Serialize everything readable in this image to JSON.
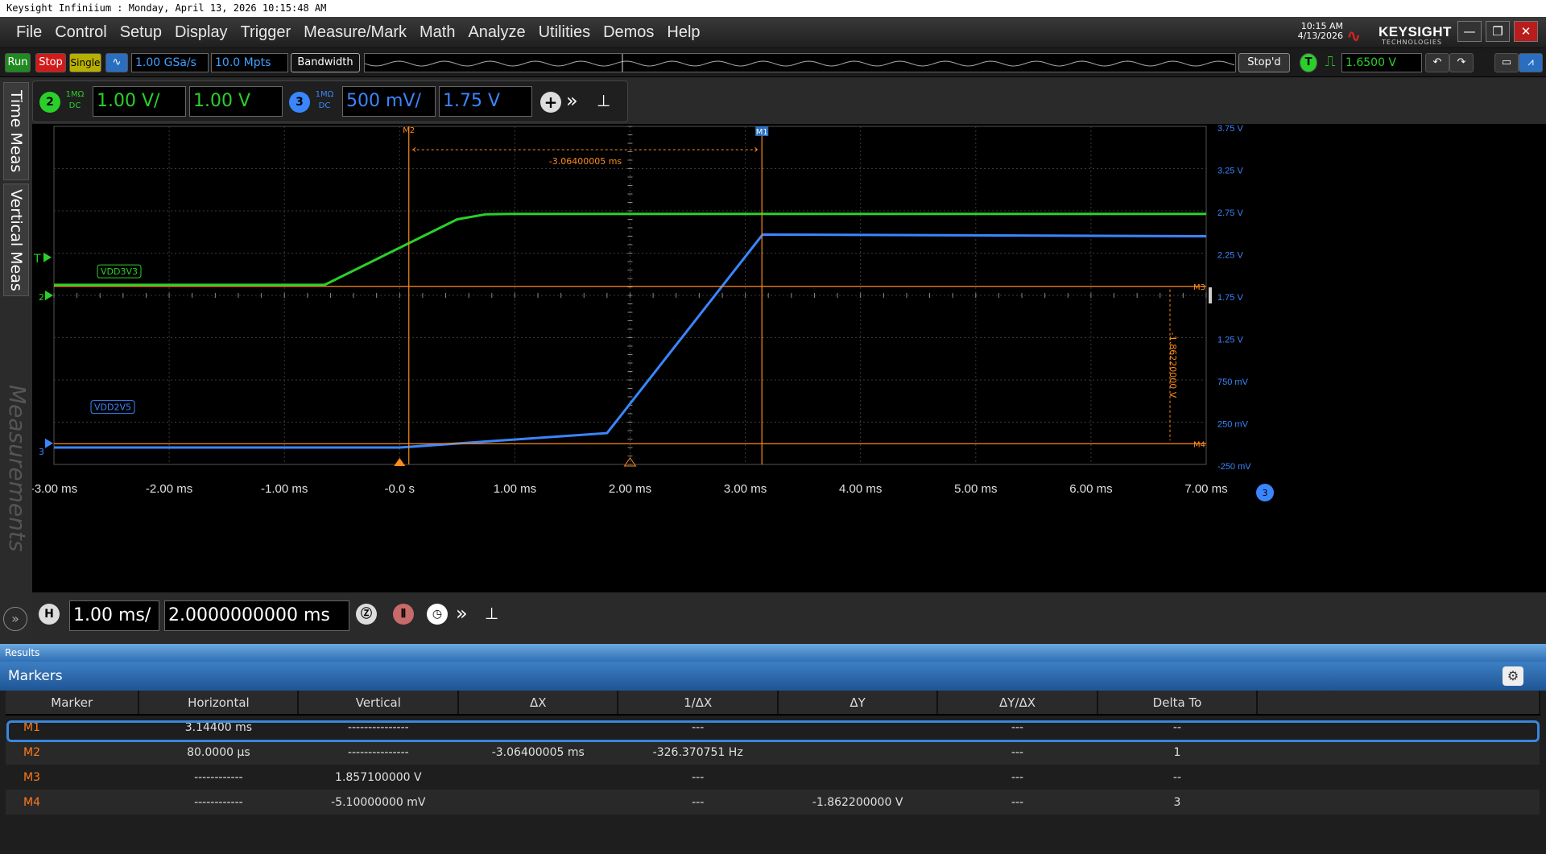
{
  "window": {
    "title": "Keysight Infiniium : Monday, April 13, 2026 10:15:48 AM"
  },
  "menu": [
    "File",
    "Control",
    "Setup",
    "Display",
    "Trigger",
    "Measure/Mark",
    "Math",
    "Analyze",
    "Utilities",
    "Demos",
    "Help"
  ],
  "clock": {
    "time": "10:15 AM",
    "date": "4/13/2026"
  },
  "brand": {
    "name": "KEYSIGHT",
    "sub": "TECHNOLOGIES"
  },
  "toolbar": {
    "run": "Run",
    "stop": "Stop",
    "single": "Single",
    "sample_rate": "1.00 GSa/s",
    "memory": "10.0 Mpts",
    "bandwidth": "Bandwidth",
    "status": "Stop'd",
    "trigger_label": "T",
    "trigger_level": "1.6500 V"
  },
  "side_tabs": {
    "time": "Time Meas",
    "vertical": "Vertical Meas",
    "measurements": "Measurements"
  },
  "channels": [
    {
      "num": "2",
      "imp": "1MΩ",
      "coupling": "DC",
      "scale": "1.00 V/",
      "offset": "1.00 V",
      "color": "#2ad02a"
    },
    {
      "num": "3",
      "imp": "1MΩ",
      "coupling": "DC",
      "scale": "500 mV/",
      "offset": "1.75 V",
      "color": "#3a86ff"
    }
  ],
  "plot": {
    "x_ticks": [
      "-3.00 ms",
      "-2.00 ms",
      "-1.00 ms",
      "-0.0 s",
      "1.00 ms",
      "2.00 ms",
      "3.00 ms",
      "4.00 ms",
      "5.00 ms",
      "6.00 ms",
      "7.00 ms"
    ],
    "y_ticks": [
      "3.75 V",
      "3.25 V",
      "2.75 V",
      "2.25 V",
      "1.75 V",
      "1.25 V",
      "750 mV",
      "250 mV",
      "-250 mV"
    ],
    "labels": {
      "ch2": "VDD3V3",
      "ch3": "VDD2V5",
      "trig": "T",
      "m1": "M1",
      "m2": "M2",
      "m3": "M3",
      "m4": "M4",
      "dx": "-3.06400005 ms",
      "dy": "-1.86220000 V",
      "ch2_marker": "2",
      "ch3_marker": "3",
      "scope_badge": "3"
    }
  },
  "chart_data": {
    "type": "line",
    "xlabel": "",
    "ylabel": "",
    "xlim": [
      -3.0,
      7.0
    ],
    "x_unit": "ms",
    "series": [
      {
        "name": "VDD3V3",
        "color": "#2ad02a",
        "x": [
          -3.0,
          -0.65,
          0.5,
          0.75,
          1.0,
          7.0
        ],
        "y": [
          1.25,
          1.25,
          2.8,
          2.92,
          2.93,
          2.93
        ],
        "scale_v_per_div": 1.0,
        "offset_v": 1.0
      },
      {
        "name": "VDD2V5",
        "color": "#3a86ff",
        "x": [
          -3.0,
          0.0,
          1.8,
          3.15,
          7.0
        ],
        "y": [
          -0.05,
          -0.05,
          0.12,
          2.47,
          2.45
        ],
        "scale_v_per_div": 0.5,
        "offset_v": 1.75
      }
    ],
    "markers": {
      "M1_ms": 3.144,
      "M2_ms": 0.08,
      "M3_v": 1.8571,
      "M4_v": -0.0051
    }
  },
  "timebase": {
    "label": "H",
    "scale": "1.00 ms/",
    "position": "2.0000000000 ms"
  },
  "results": {
    "header": "Results",
    "section": "Markers",
    "columns": [
      "Marker",
      "Horizontal",
      "Vertical",
      "ΔX",
      "1/ΔX",
      "ΔY",
      "ΔY/ΔX",
      "Delta To"
    ],
    "rows": [
      [
        "M1",
        "3.14400 ms",
        "---------------",
        "",
        "---",
        "",
        "---",
        "--"
      ],
      [
        "M2",
        "80.0000 µs",
        "---------------",
        "-3.06400005 ms",
        "-326.370751 Hz",
        "",
        "---",
        "1"
      ],
      [
        "M3",
        "------------",
        "1.857100000 V",
        "",
        "---",
        "",
        "---",
        "--"
      ],
      [
        "M4",
        "------------",
        "-5.10000000 mV",
        "",
        "---",
        "-1.862200000 V",
        "---",
        "3"
      ]
    ]
  }
}
